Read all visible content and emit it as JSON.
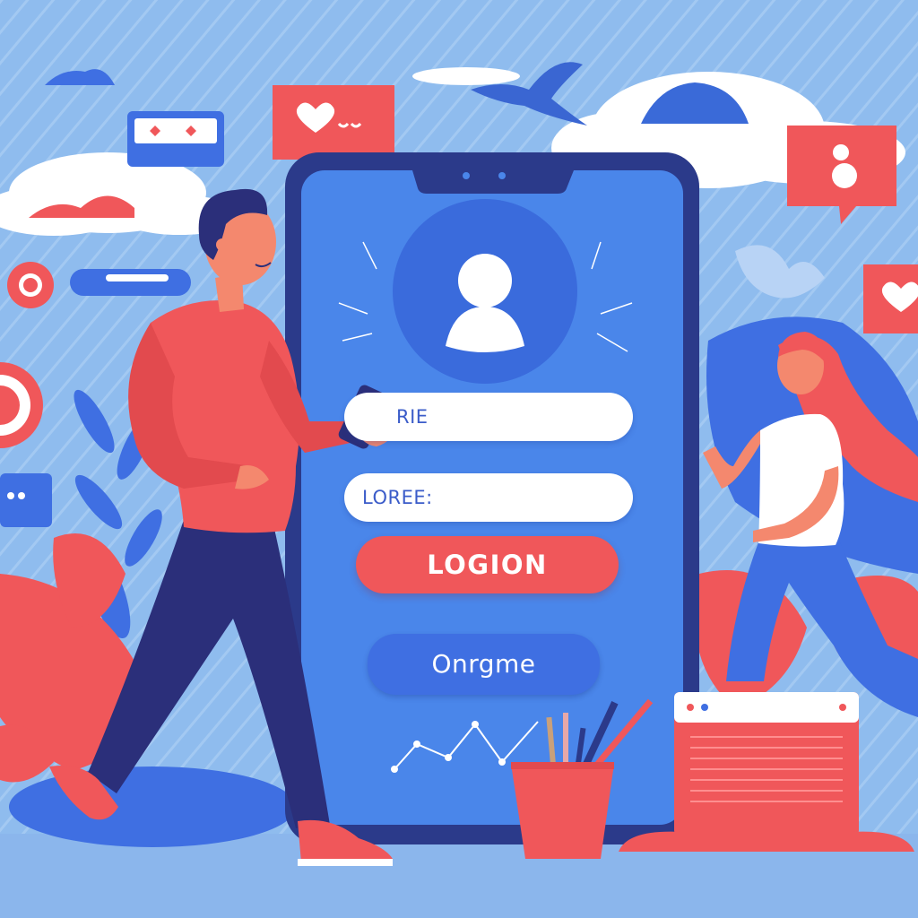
{
  "scene": {
    "description_type": "flat illustration of a mobile login screen",
    "colors": {
      "background": "#8fbcee",
      "phone_body": "#2b3a8a",
      "phone_screen": "#4a86ea",
      "accent_red": "#f0575a",
      "button_blue": "#3f6fe2",
      "field_white": "#ffffff"
    }
  },
  "login_form": {
    "avatar_icon": "user-silhouette-icon",
    "username_field_text": "RIE",
    "password_field_text": "LOREE:",
    "login_button_label": "LOGION",
    "secondary_button_label": "Onrgme"
  },
  "decorations": {
    "icons": [
      "heart-chat-bubble-icon",
      "chat-bubble-icon",
      "bird-icon",
      "cloud-icon",
      "target-icon",
      "pencil-cup-icon",
      "browser-window-icon",
      "line-graph-icon"
    ]
  }
}
